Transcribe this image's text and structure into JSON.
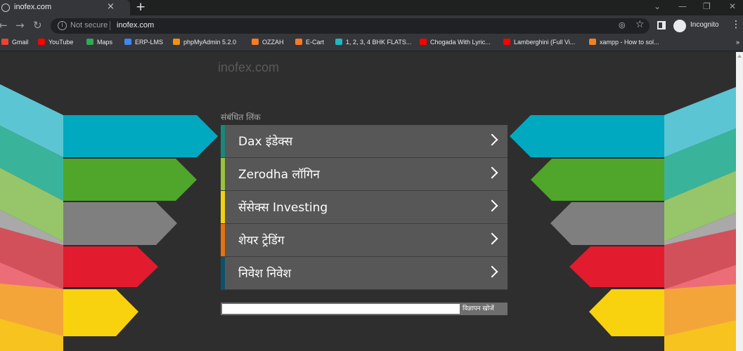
{
  "browser": {
    "tab_title": "inofex.com",
    "tab_close": "×",
    "new_tab": "+",
    "url_security": "Not secure",
    "url": "inofex.com",
    "profile_label": "Incognito"
  },
  "bookmarks": [
    {
      "label": "Gmail",
      "color": "#ea4335"
    },
    {
      "label": "YouTube",
      "color": "#ff0000"
    },
    {
      "label": "Maps",
      "color": "#34a853"
    },
    {
      "label": "ERP-LMS",
      "color": "#4285f4"
    },
    {
      "label": "phpMyAdmin 5.2.0",
      "color": "#f29111"
    },
    {
      "label": "OZZAH",
      "color": "#fb7a24"
    },
    {
      "label": "E-Cart",
      "color": "#fb7a24"
    },
    {
      "label": "1, 2, 3, 4 BHK FLATS...",
      "color": "#1fb7c2"
    },
    {
      "label": "Chogada With Lyric...",
      "color": "#ff0000"
    },
    {
      "label": "Lamberghini (Full Vi...",
      "color": "#ff0000"
    },
    {
      "label": "xampp - How to sol...",
      "color": "#f48024"
    }
  ],
  "page": {
    "site_name": "inofex.com",
    "related_heading": "संबंधित लिंक",
    "links": [
      {
        "label": "Dax इंडेक्स",
        "accent": "#18887a"
      },
      {
        "label": "Zerodha लॉगिन",
        "accent": "#9ac33b"
      },
      {
        "label": "सेंसेक्स Investing",
        "accent": "#f1d20f"
      },
      {
        "label": "शेयर ट्रेडिंग",
        "accent": "#e6710f"
      },
      {
        "label": "निवेश निवेश",
        "accent": "#0f4f6a"
      }
    ],
    "search_placeholder": "",
    "search_button": "विज्ञापन खोजें"
  }
}
